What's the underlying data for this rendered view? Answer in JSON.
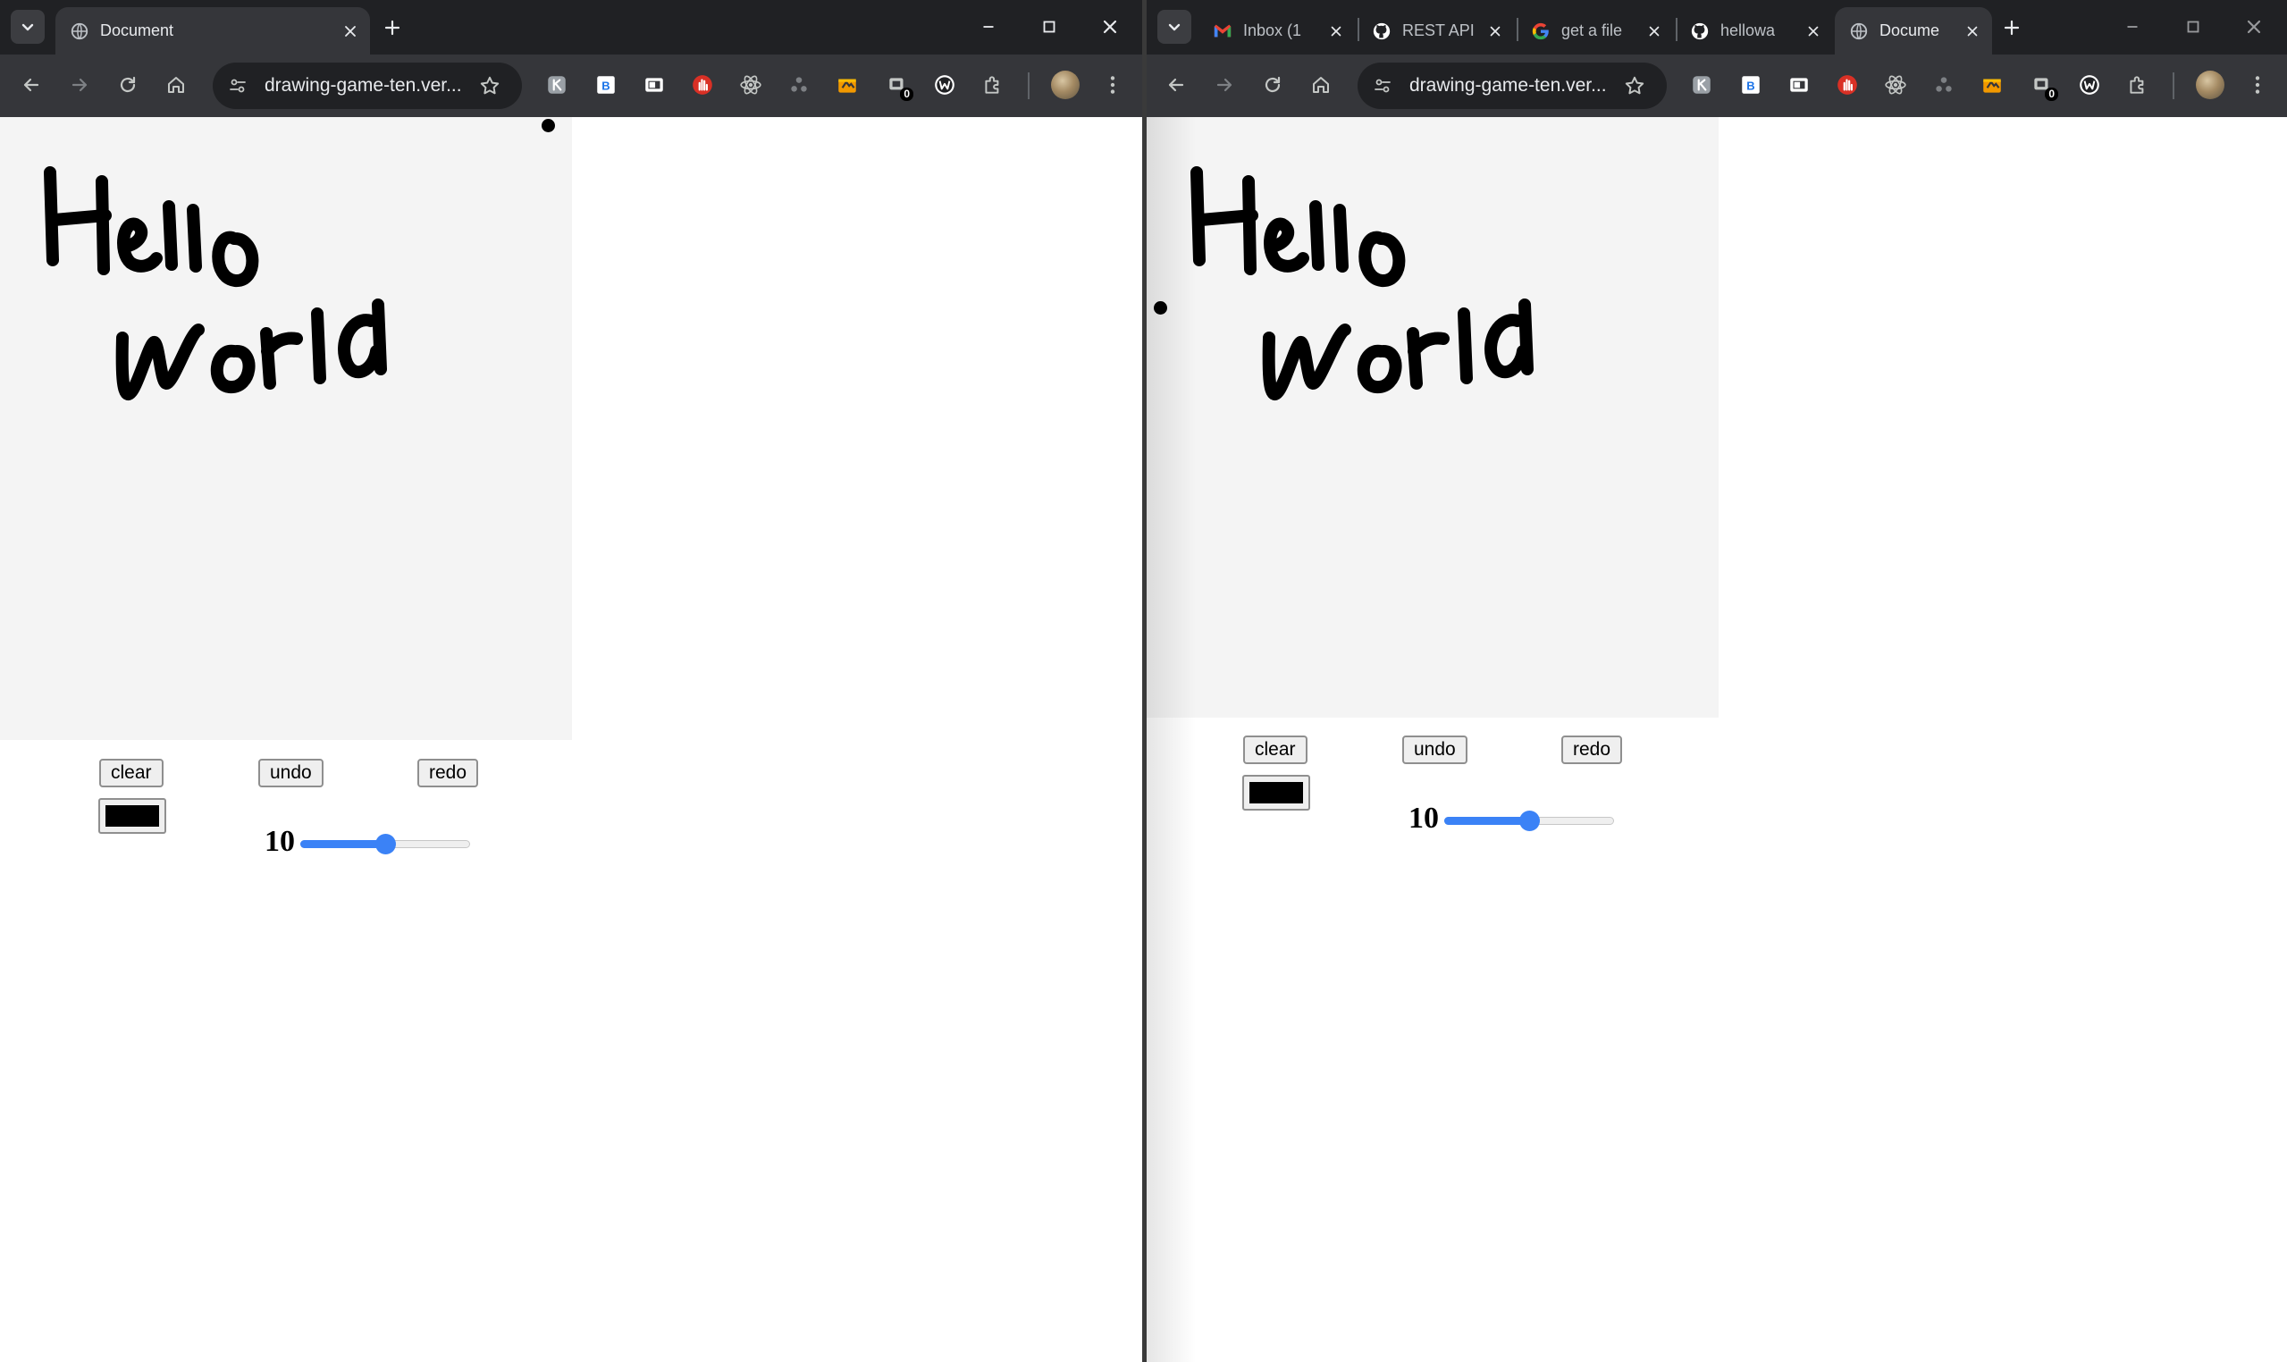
{
  "left_window": {
    "tabs": [
      {
        "title": "Document",
        "favicon": "globe-icon",
        "active": true
      }
    ],
    "address": "drawing-game-ten.ver...",
    "extension_badge": "0",
    "app": {
      "drawing_text": [
        "Hello",
        "world"
      ],
      "buttons": {
        "clear": "clear",
        "undo": "undo",
        "redo": "redo"
      },
      "pen_color": "#000000",
      "brush_size_label": "10",
      "brush_size_value": 10,
      "brush_slider_fraction": 0.5
    }
  },
  "right_window": {
    "tabs": [
      {
        "title": "Inbox (1",
        "favicon": "gmail-icon",
        "active": false
      },
      {
        "title": "REST API",
        "favicon": "github-icon",
        "active": false
      },
      {
        "title": "get a file",
        "favicon": "google-icon",
        "active": false
      },
      {
        "title": "hellowa",
        "favicon": "github-icon",
        "active": false
      },
      {
        "title": "Docume",
        "favicon": "globe-icon",
        "active": true
      }
    ],
    "address": "drawing-game-ten.ver...",
    "extension_badge": "0",
    "app": {
      "drawing_text": [
        "Hello",
        "world"
      ],
      "buttons": {
        "clear": "clear",
        "undo": "undo",
        "redo": "redo"
      },
      "pen_color": "#000000",
      "brush_size_label": "10",
      "brush_size_value": 10,
      "brush_slider_fraction": 0.5
    }
  },
  "colors": {
    "tabstrip": "#202124",
    "toolbar": "#35363a",
    "canvas_bg": "#f4f4f4",
    "accent": "#3b82f6"
  }
}
